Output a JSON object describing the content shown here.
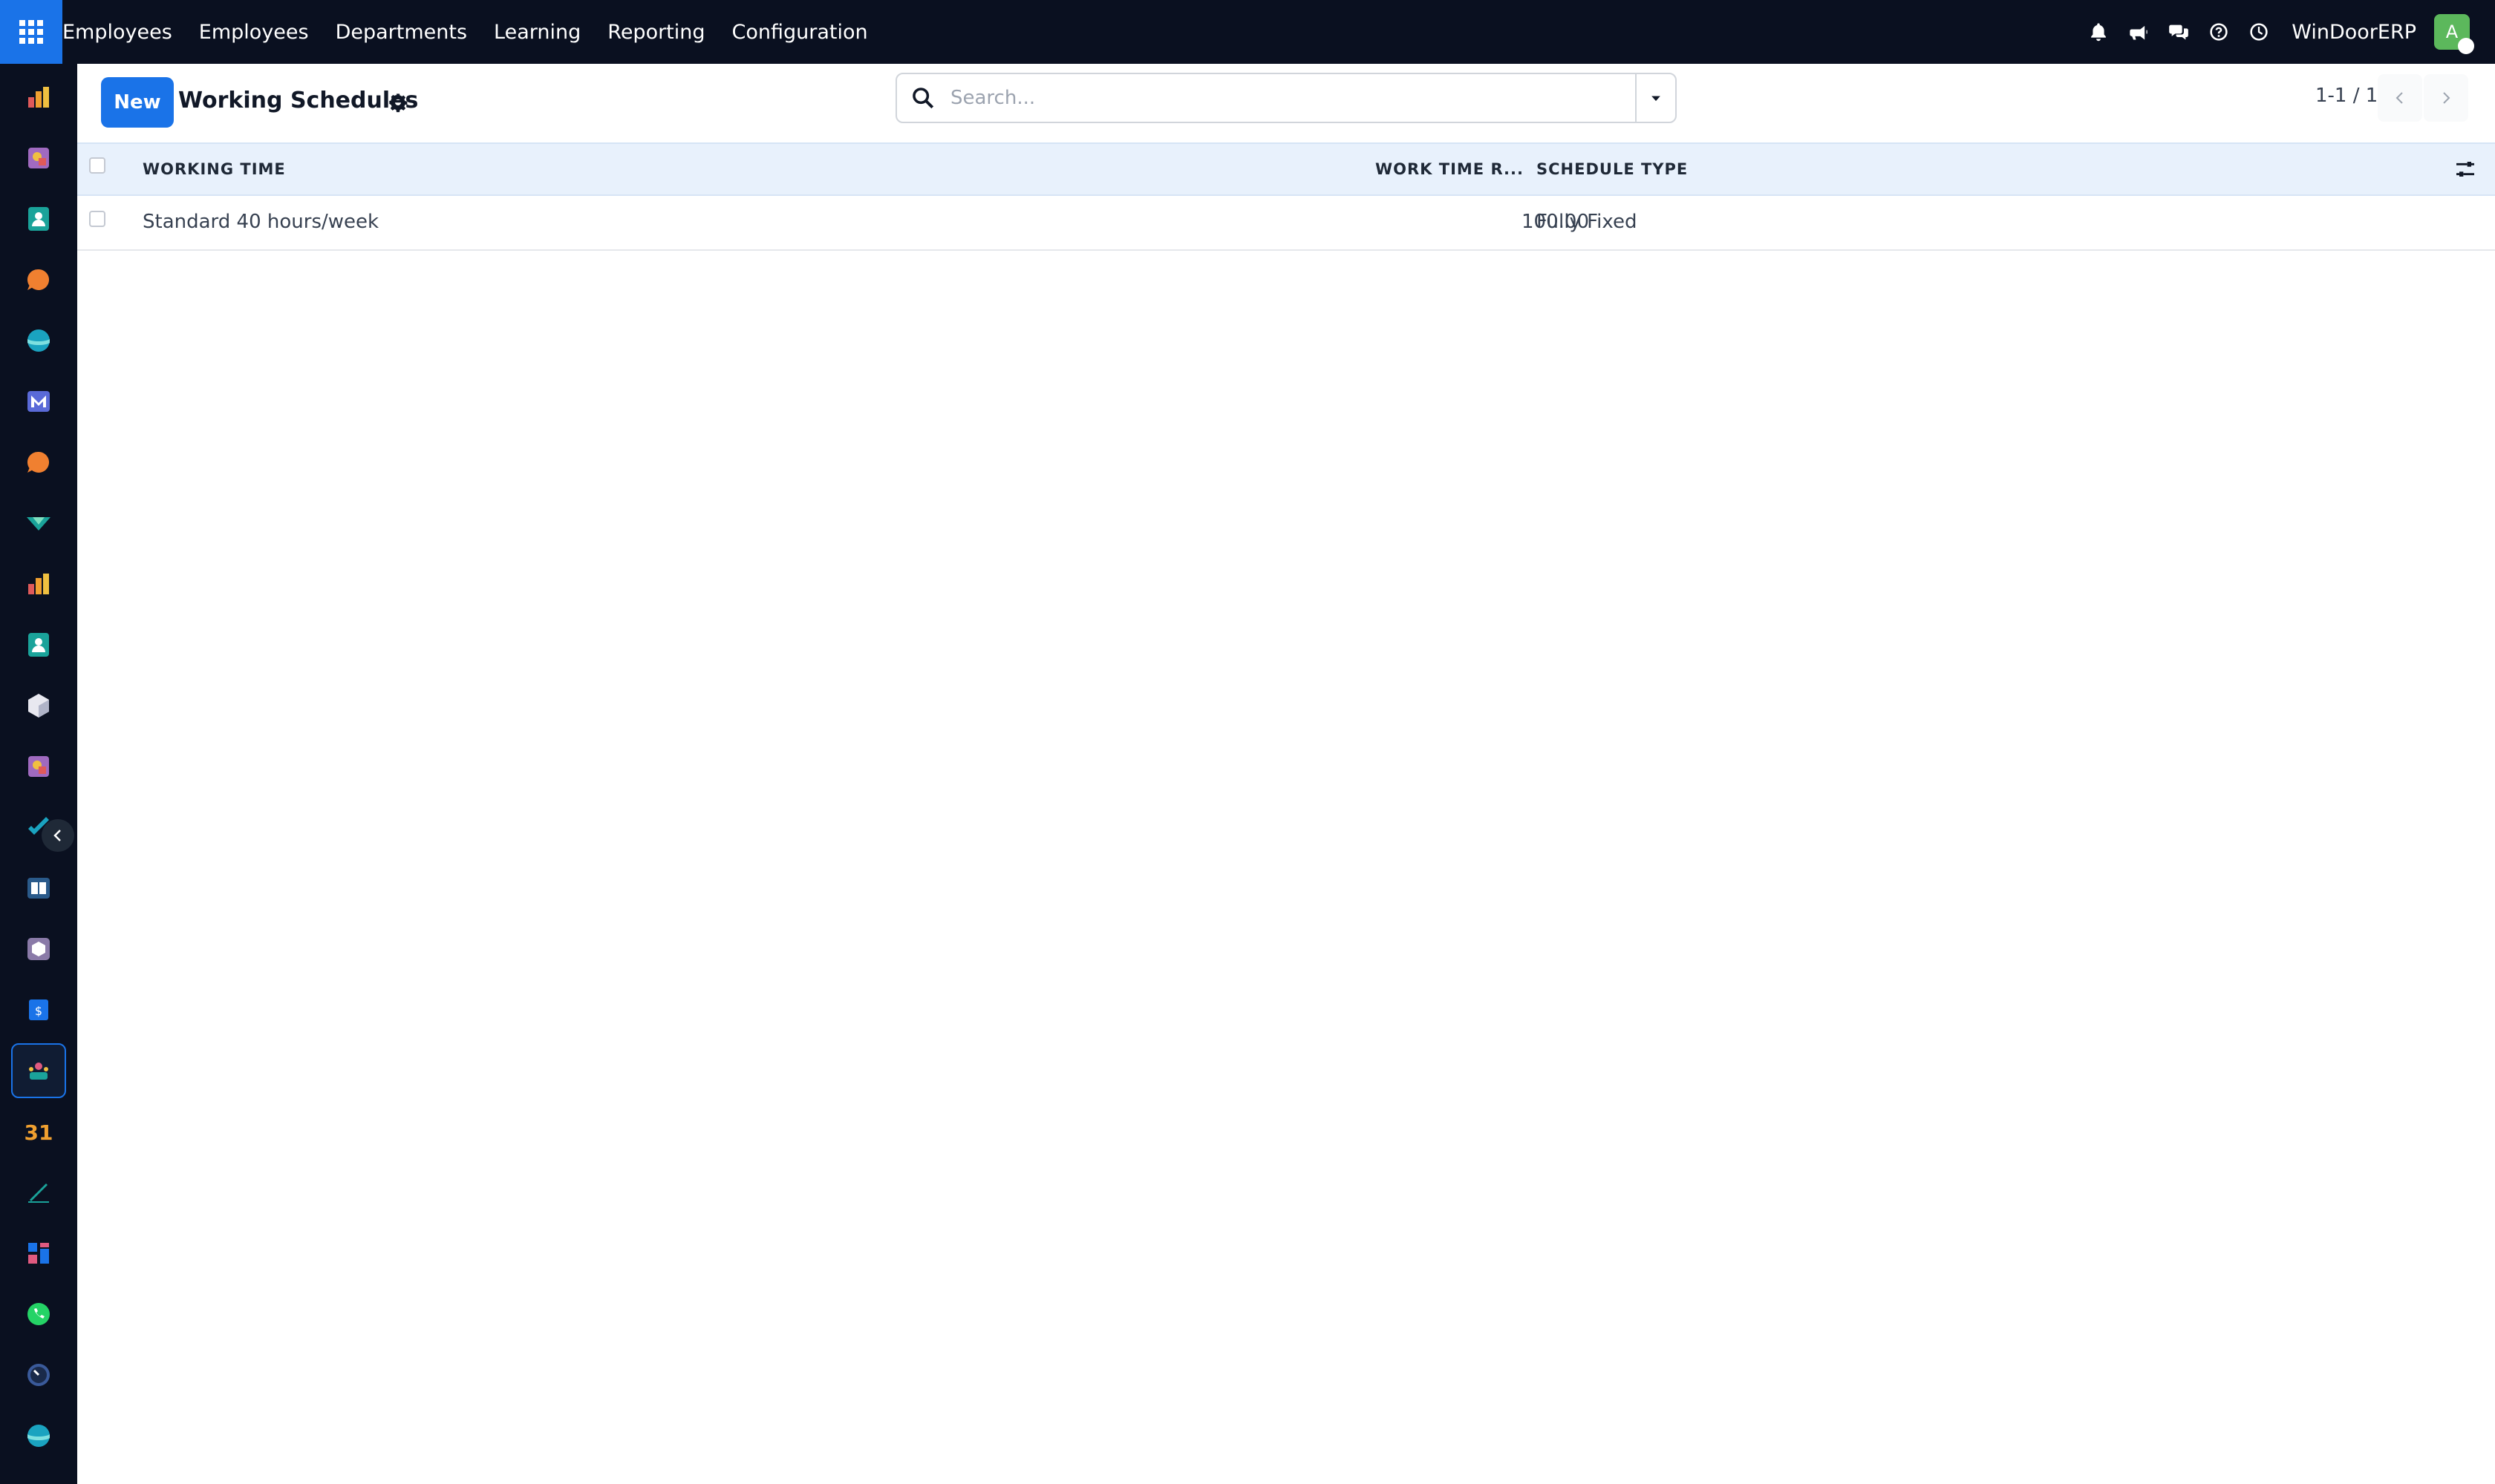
{
  "navbar": {
    "app_name": "Employees",
    "menu": [
      "Employees",
      "Departments",
      "Learning",
      "Reporting",
      "Configuration"
    ],
    "company": "WinDoorERP",
    "avatar_letter": "A",
    "icons": [
      "bell-icon",
      "megaphone-icon",
      "chat-icon",
      "help-icon",
      "clock-icon"
    ],
    "colors": {
      "background": "#0a1020",
      "apps_button": "#1a73e8",
      "avatar": "#5cb85c"
    }
  },
  "sidebar": {
    "apps": [
      "dashboard-app",
      "sales-app",
      "contacts-app",
      "discuss-app",
      "website-app",
      "email-marketing-app",
      "livechat-app",
      "crm-app",
      "dashboard-app-2",
      "contacts-app-2",
      "inventory-app",
      "sales-app-2",
      "project-app",
      "knowledge-app",
      "purchase-app",
      "accounting-app",
      "employees-app",
      "calendar-app",
      "sign-app",
      "dashboards-app",
      "whatsapp-app",
      "timesheet-app",
      "website-app-2"
    ],
    "active_app": "employees-app",
    "calendar_label": "31"
  },
  "control_panel": {
    "new_label": "New",
    "title": "Working Schedules",
    "search": {
      "placeholder": "Search...",
      "value": ""
    },
    "pager": "1-1 / 1"
  },
  "list": {
    "columns": [
      "WORKING TIME",
      "WORK TIME R...",
      "SCHEDULE TYPE"
    ],
    "rows": [
      {
        "working_time": "Standard 40 hours/week",
        "work_time_rate": "100.00",
        "schedule_type": "Fully Fixed"
      }
    ],
    "header_color": "#e8f1fc"
  }
}
